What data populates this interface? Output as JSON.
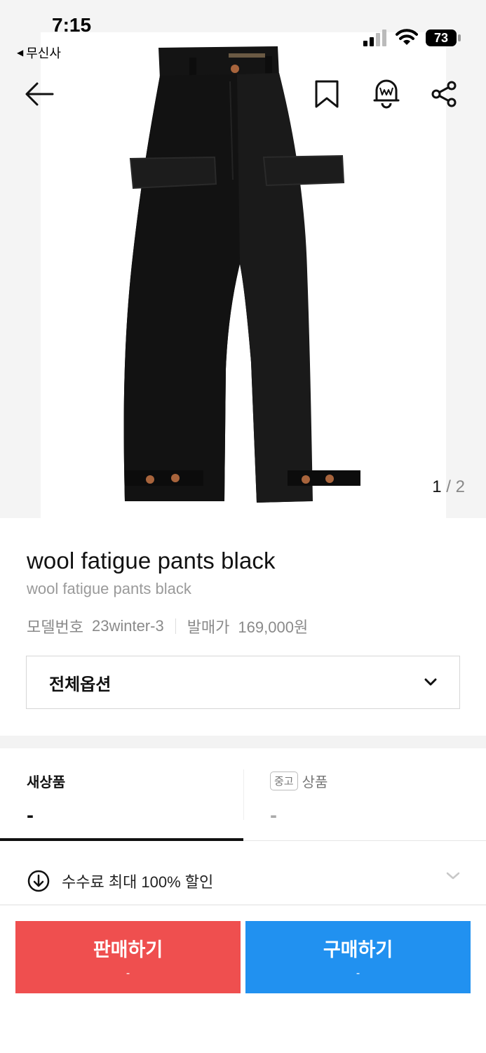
{
  "status_bar": {
    "time": "7:15",
    "back_app": "무신사",
    "battery": "73"
  },
  "gallery": {
    "current": "1",
    "separator": "/",
    "total": "2"
  },
  "product": {
    "title": "wool fatigue pants black",
    "subtitle": "wool fatigue pants black",
    "model_label": "모델번호",
    "model_value": "23winter-3",
    "release_label": "발매가",
    "release_value": "169,000원"
  },
  "options": {
    "label": "전체옵션"
  },
  "tabs": {
    "new": {
      "label": "새상품",
      "value": "-"
    },
    "used": {
      "badge": "중고",
      "label": "상품",
      "value": "-"
    }
  },
  "fee": {
    "text": "수수료 최대 100% 할인"
  },
  "actions": {
    "sell": {
      "label": "판매하기",
      "price": "-",
      "color": "#ef4f4f"
    },
    "buy": {
      "label": "구매하기",
      "price": "-",
      "color": "#2191f0"
    }
  },
  "icons": {
    "back": "arrow-left-icon",
    "bookmark": "bookmark-icon",
    "alert": "bell-icon",
    "share": "share-icon",
    "option_dropdown": "chevron-down-icon",
    "fee": "download-circle-icon"
  }
}
